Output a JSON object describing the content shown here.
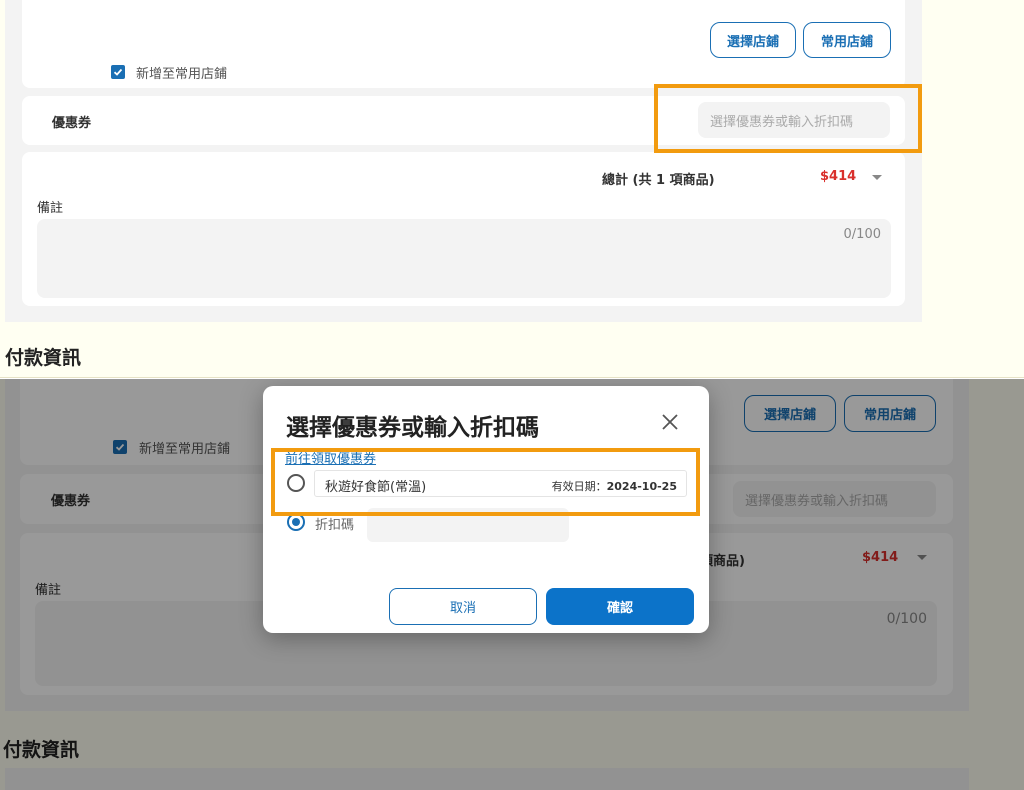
{
  "store": {
    "select_store_label": "選擇店鋪",
    "favorite_store_label": "常用店鋪",
    "add_favorite_label": "新增至常用店鋪"
  },
  "coupon": {
    "label": "優惠券",
    "placeholder": "選擇優惠券或輸入折扣碼"
  },
  "summary": {
    "total_label": "總計 (共 1 項商品)",
    "total_label_partial": "項商品)",
    "total_price": "$414"
  },
  "notes": {
    "label": "備註",
    "counter": "0/100"
  },
  "payment": {
    "title": "付款資訊"
  },
  "modal": {
    "title": "選擇優惠券或輸入折扣碼",
    "link": "前往領取優惠券",
    "coupon_name": "秋遊好食節(常溫)",
    "coupon_validity_label": "有效日期：",
    "coupon_validity_date": "2024-10-25",
    "code_label": "折扣碼",
    "cancel_label": "取消",
    "confirm_label": "確認"
  },
  "colors": {
    "accent": "#1a6fb4",
    "price": "#d9302c",
    "highlight": "#f29b0f"
  }
}
